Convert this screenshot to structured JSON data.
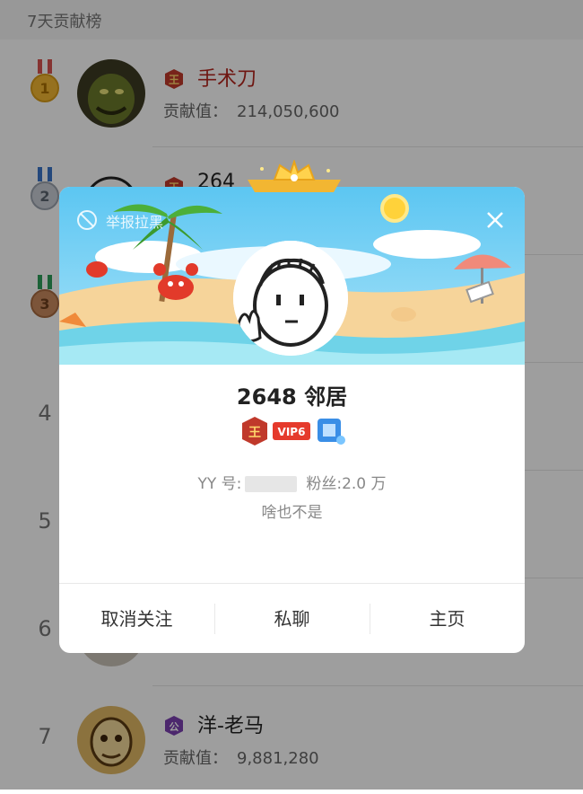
{
  "header": {
    "title": "7天贡献榜"
  },
  "contrib_label": "贡献值：",
  "rows": [
    {
      "rank": "1",
      "name": "手术刀",
      "badge": "王",
      "contribution": "214,050,600"
    },
    {
      "rank": "2",
      "name": "264",
      "badge": "王",
      "contribution": ""
    },
    {
      "rank": "3",
      "name": "",
      "badge": "",
      "contribution": ""
    },
    {
      "rank": "4",
      "name": "",
      "badge": "",
      "contribution": ""
    },
    {
      "rank": "5",
      "name": "",
      "badge": "",
      "contribution": ""
    },
    {
      "rank": "6",
      "name": "",
      "badge": "",
      "contribution": ""
    },
    {
      "rank": "7",
      "name": "洋-老马",
      "badge": "公",
      "contribution": "9,881,280"
    }
  ],
  "modal": {
    "block_label": "举报拉黑",
    "name": "2648 邻居",
    "badge_king": "王",
    "badge_vip": "VIP6",
    "yy_label": "YY 号:",
    "fans": "粉丝:2.0 万",
    "signature": "啥也不是",
    "actions": [
      "取消关注",
      "私聊",
      "主页"
    ]
  },
  "colors": {
    "red": "#b3261e",
    "vip": "#e53a2c",
    "gold": "#f2b632"
  }
}
